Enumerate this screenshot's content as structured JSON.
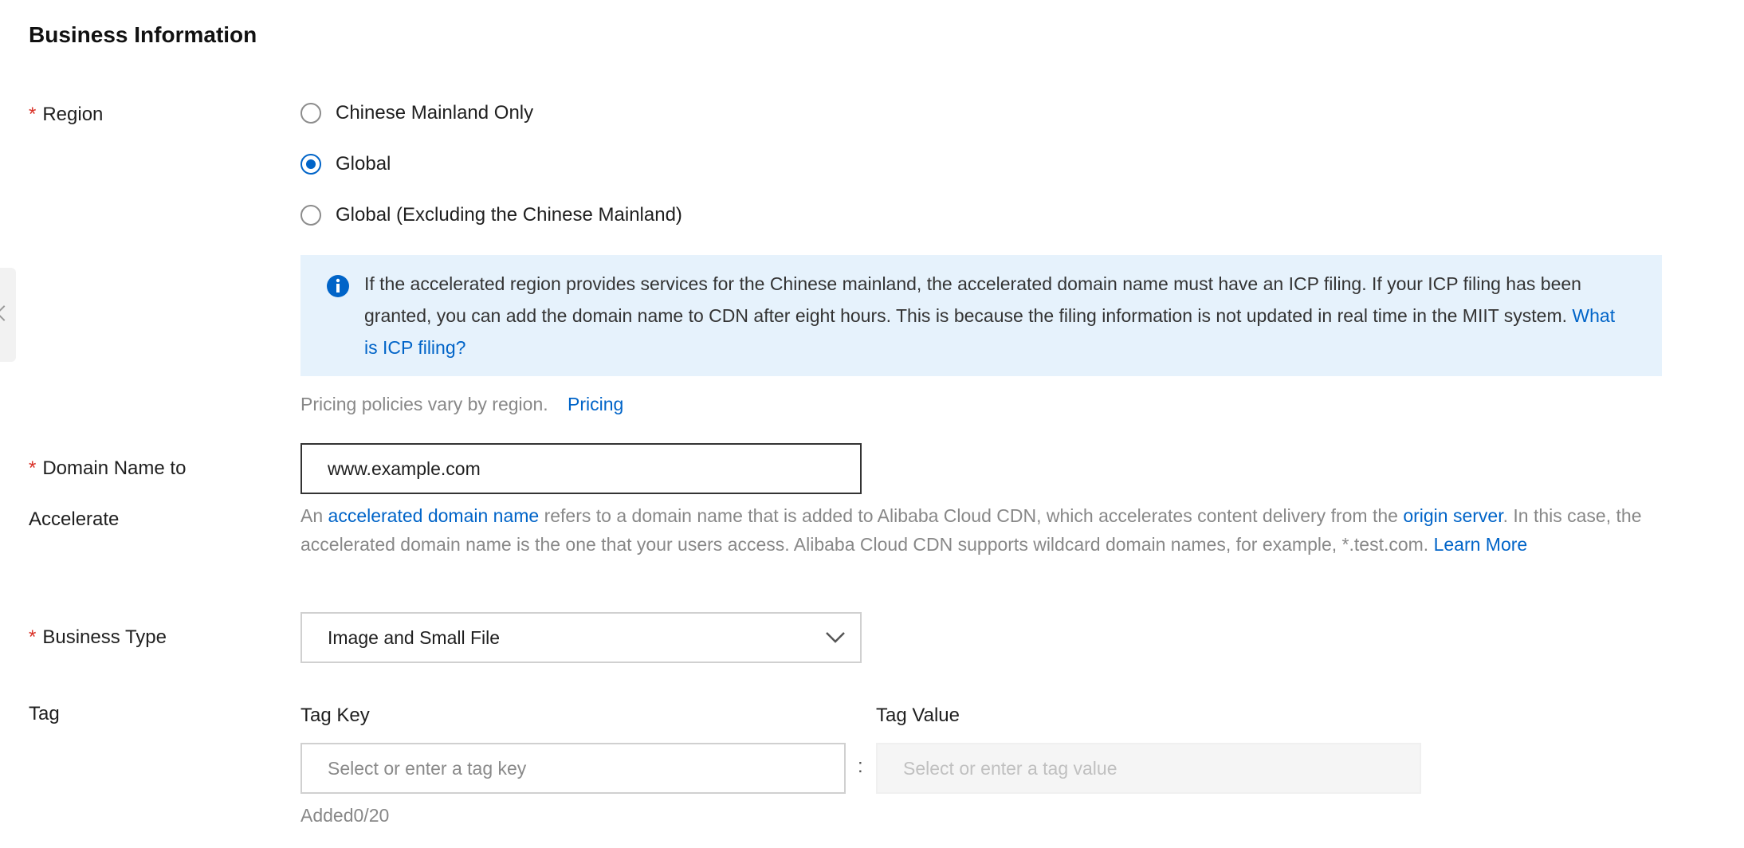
{
  "section": {
    "title": "Business Information"
  },
  "region": {
    "label": "Region",
    "options": [
      {
        "label": "Chinese Mainland Only",
        "checked": false
      },
      {
        "label": "Global",
        "checked": true
      },
      {
        "label": "Global (Excluding the Chinese Mainland)",
        "checked": false
      }
    ],
    "notice": {
      "text": "If the accelerated region provides services for the Chinese mainland, the accelerated domain name must have an ICP filing. If your ICP filing has been granted, you can add the domain name to CDN after eight hours. This is because the filing information is not updated in real time in the MIIT system.",
      "link": "What is ICP filing?"
    },
    "pricing_hint": "Pricing policies vary by region.",
    "pricing_link": "Pricing"
  },
  "domain": {
    "label_line1": "Domain Name to",
    "label_line2": "Accelerate",
    "value": "www.example.com",
    "desc_1": "An",
    "desc_link_1": "accelerated domain name",
    "desc_2": "refers to a domain name that is added to Alibaba Cloud CDN, which accelerates content delivery from the",
    "desc_link_2": "origin server",
    "desc_3": ". In this case, the accelerated domain name is the one that your users access. Alibaba Cloud CDN supports wildcard domain names, for example, *.test.com.",
    "desc_link_3": "Learn More"
  },
  "business_type": {
    "label": "Business Type",
    "selected": "Image and Small File"
  },
  "tag": {
    "label": "Tag",
    "key_label": "Tag Key",
    "value_label": "Tag Value",
    "key_placeholder": "Select or enter a tag key",
    "value_placeholder": "Select or enter a tag value",
    "separator": ":",
    "count": "Added0/20"
  },
  "colors": {
    "accent": "#0064c8",
    "required": "#d93026",
    "notice_bg": "#e6f2fc"
  },
  "icons": {
    "info": "info-circle-icon",
    "dropdown": "chevron-down-icon",
    "collapse": "chevron-left-icon"
  }
}
